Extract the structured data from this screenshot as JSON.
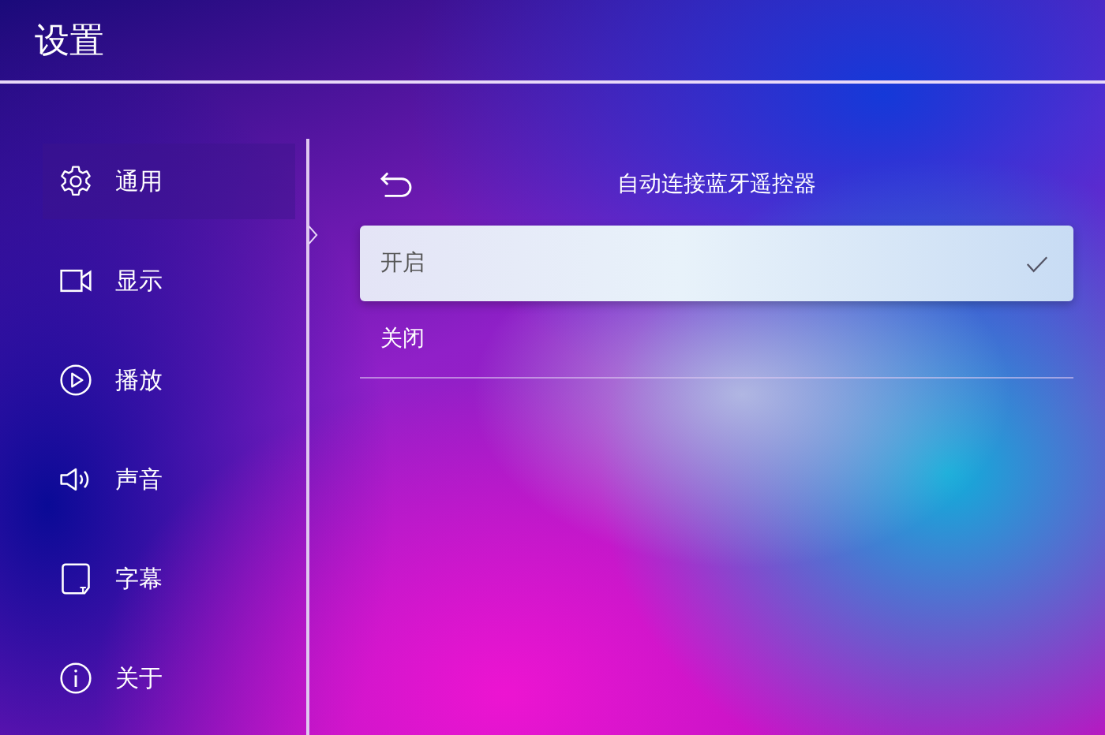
{
  "window": {
    "title": "设置"
  },
  "sidebar": {
    "items": [
      {
        "label": "通用",
        "selected": true
      },
      {
        "label": "显示",
        "selected": false
      },
      {
        "label": "播放",
        "selected": false
      },
      {
        "label": "声音",
        "selected": false
      },
      {
        "label": "字幕",
        "selected": false
      },
      {
        "label": "关于",
        "selected": false
      }
    ]
  },
  "panel": {
    "title": "自动连接蓝牙遥控器",
    "options": [
      {
        "label": "开启",
        "selected": true
      },
      {
        "label": "关闭",
        "selected": false
      }
    ]
  }
}
